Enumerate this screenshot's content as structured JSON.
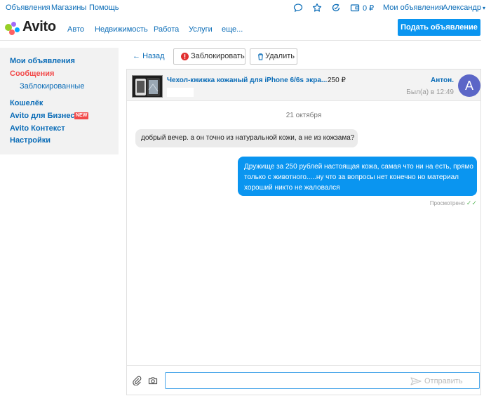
{
  "topbar": {
    "links": [
      "Объявления",
      "Магазины",
      "Помощь"
    ],
    "wallet_amount": "0 ₽",
    "my_ads": "Мои объявления",
    "user": "Александр"
  },
  "header": {
    "logo": "Avito",
    "nav": [
      "Авто",
      "Недвижимость",
      "Работа",
      "Услуги",
      "еще..."
    ],
    "post_button": "Подать объявление"
  },
  "sidebar": {
    "my_ads": "Мои объявления",
    "messages": "Сообщения",
    "blocked": "Заблокированные",
    "wallet": "Кошелёк",
    "business": "Avito для Бизнеса",
    "new_badge": "NEW",
    "context": "Avito Контекст",
    "settings": "Настройки"
  },
  "toolbar": {
    "back": "Назад",
    "block": "Заблокировать",
    "delete": "Удалить"
  },
  "chat": {
    "item_title": "Чехол-книжка кожаный для iPhone 6/6s экра...",
    "item_price": "250 ₽",
    "user_name": "Антон.",
    "last_seen": "Был(а) в 12:49",
    "avatar_letter": "A",
    "date": "21 октября",
    "incoming": "добрый вечер. а он точно из натуральной кожи, а не из кожзама?",
    "outgoing": [
      "Дружище за 250 рублей настоящая кожа, самая что ни на есть, прямо",
      "только с животного.....ну что за вопросы нет конечно но материал",
      "хороший никто не жаловался"
    ],
    "seen": "Просмотрено",
    "seen_check": "✓✓"
  },
  "composer": {
    "value": "",
    "send_label": "Отправить"
  },
  "colors": {
    "link": "#0a6cb7",
    "accent_blue": "#0a95f0",
    "active_red": "#f24a4a",
    "avatar": "#5b66c7"
  }
}
